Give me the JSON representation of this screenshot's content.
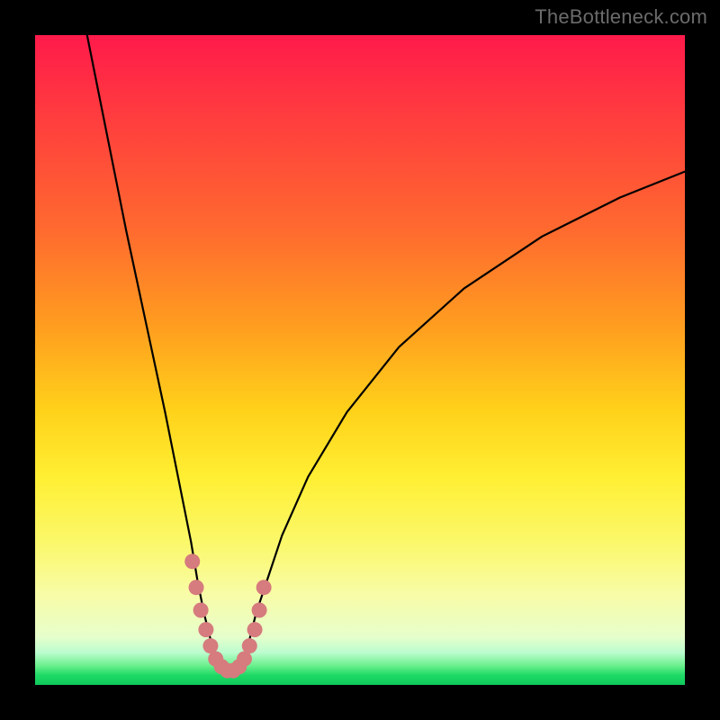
{
  "watermark": "TheBottleneck.com",
  "colors": {
    "frame": "#000000",
    "curve": "#000000",
    "marker_fill": "#d67b7e",
    "marker_stroke": "#c75f63"
  },
  "chart_data": {
    "type": "line",
    "title": "",
    "xlabel": "",
    "ylabel": "",
    "xlim": [
      0,
      100
    ],
    "ylim": [
      0,
      100
    ],
    "grid": false,
    "legend": false,
    "note": "Values are approximate; chart has no visible numeric tick labels, so x and y are normalized 0–100 by plot-area extent (x left→right, y bottom→top).",
    "series": [
      {
        "name": "bottleneck-curve",
        "x": [
          8,
          11,
          14,
          17,
          20,
          22,
          24,
          25,
          26,
          27,
          28,
          29,
          30,
          31,
          32,
          33,
          34,
          36,
          38,
          42,
          48,
          56,
          66,
          78,
          90,
          100
        ],
        "y": [
          100,
          85,
          70,
          56,
          42,
          32,
          22,
          16,
          11,
          7,
          4,
          2.5,
          2,
          2.5,
          4,
          7,
          11,
          17,
          23,
          32,
          42,
          52,
          61,
          69,
          75,
          79
        ]
      }
    ],
    "markers": {
      "name": "highlighted-segment",
      "note": "Thick salmon markers overlaid along the valley bottom of the curve.",
      "x": [
        24.2,
        24.8,
        25.5,
        26.3,
        27.0,
        27.8,
        28.7,
        29.6,
        30.5,
        31.4,
        32.2,
        33.0,
        33.8,
        34.5,
        35.2
      ],
      "y": [
        19.0,
        15.0,
        11.5,
        8.5,
        6.0,
        4.0,
        2.8,
        2.2,
        2.2,
        2.8,
        4.0,
        6.0,
        8.5,
        11.5,
        15.0
      ]
    }
  }
}
